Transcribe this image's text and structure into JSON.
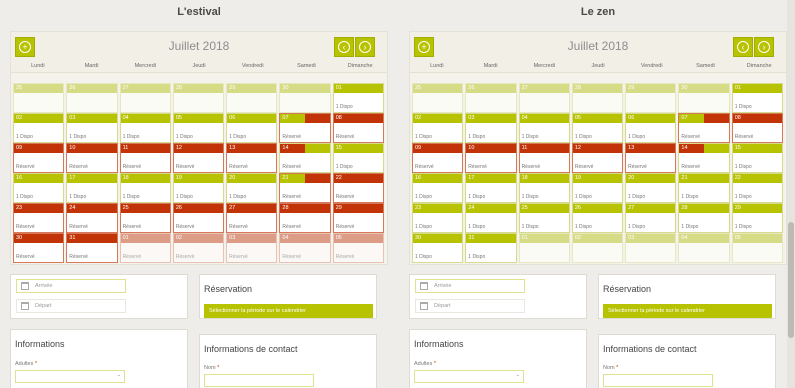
{
  "left": {
    "title": "L'estival",
    "month": "Juillet 2018",
    "dows": [
      "Lundi",
      "Mardi",
      "Mercredi",
      "Jeudi",
      "Vendredi",
      "Samedi",
      "Dimanche"
    ],
    "cells": [
      [
        "25",
        "",
        "od"
      ],
      [
        "26",
        "",
        "od"
      ],
      [
        "27",
        "",
        "od"
      ],
      [
        "28",
        "",
        "od"
      ],
      [
        "29",
        "",
        "od"
      ],
      [
        "30",
        "",
        "od"
      ],
      [
        "01",
        "1 Dispo",
        "d"
      ],
      [
        "02",
        "1 Dispo",
        "d"
      ],
      [
        "03",
        "1 Dispo",
        "d"
      ],
      [
        "04",
        "1 Dispo",
        "d"
      ],
      [
        "05",
        "1 Dispo",
        "d"
      ],
      [
        "06",
        "1 Dispo",
        "d"
      ],
      [
        "07",
        "Réservé",
        "ta"
      ],
      [
        "08",
        "Réservé",
        "r"
      ],
      [
        "09",
        "Réservé",
        "r"
      ],
      [
        "10",
        "Réservé",
        "r"
      ],
      [
        "11",
        "Réservé",
        "r"
      ],
      [
        "12",
        "Réservé",
        "r"
      ],
      [
        "13",
        "Réservé",
        "r"
      ],
      [
        "14",
        "Réservé",
        "tb"
      ],
      [
        "15",
        "1 Dispo",
        "d"
      ],
      [
        "16",
        "1 Dispo",
        "d"
      ],
      [
        "17",
        "1 Dispo",
        "d"
      ],
      [
        "18",
        "1 Dispo",
        "d"
      ],
      [
        "19",
        "1 Dispo",
        "d"
      ],
      [
        "20",
        "1 Dispo",
        "d"
      ],
      [
        "21",
        "Réservé",
        "ta"
      ],
      [
        "22",
        "Réservé",
        "r"
      ],
      [
        "23",
        "Réservé",
        "r"
      ],
      [
        "24",
        "Réservé",
        "r"
      ],
      [
        "25",
        "Réservé",
        "r"
      ],
      [
        "26",
        "Réservé",
        "r"
      ],
      [
        "27",
        "Réservé",
        "r"
      ],
      [
        "28",
        "Réservé",
        "r"
      ],
      [
        "29",
        "Réservé",
        "r"
      ],
      [
        "30",
        "Réservé",
        "r"
      ],
      [
        "31",
        "Réservé",
        "r"
      ],
      [
        "01",
        "Réservé",
        "or"
      ],
      [
        "02",
        "Réservé",
        "or"
      ],
      [
        "03",
        "Réservé",
        "or"
      ],
      [
        "04",
        "Réservé",
        "or"
      ],
      [
        "05",
        "Réservé",
        "or"
      ]
    ],
    "arrivee": "Arrivée",
    "depart": "Départ",
    "reservation_title": "Réservation",
    "select_label": "Sélectionner la période sur le calendrier",
    "info_title": "Informations",
    "adultes_label": "Adultes",
    "contact_title": "Informations de contact",
    "nom_label": "Nom"
  },
  "right": {
    "title": "Le zen",
    "month": "Juillet 2018",
    "dows": [
      "Lundi",
      "Mardi",
      "Mercredi",
      "Jeudi",
      "Vendredi",
      "Samedi",
      "Dimanche"
    ],
    "cells": [
      [
        "25",
        "",
        "od"
      ],
      [
        "26",
        "",
        "od"
      ],
      [
        "27",
        "",
        "od"
      ],
      [
        "28",
        "",
        "od"
      ],
      [
        "29",
        "",
        "od"
      ],
      [
        "30",
        "",
        "od"
      ],
      [
        "01",
        "1 Dispo",
        "d"
      ],
      [
        "02",
        "1 Dispo",
        "d"
      ],
      [
        "03",
        "1 Dispo",
        "d"
      ],
      [
        "04",
        "1 Dispo",
        "d"
      ],
      [
        "05",
        "1 Dispo",
        "d"
      ],
      [
        "06",
        "1 Dispo",
        "d"
      ],
      [
        "07",
        "Réservé",
        "ta"
      ],
      [
        "08",
        "Réservé",
        "r"
      ],
      [
        "09",
        "Réservé",
        "r"
      ],
      [
        "10",
        "Réservé",
        "r"
      ],
      [
        "11",
        "Réservé",
        "r"
      ],
      [
        "12",
        "Réservé",
        "r"
      ],
      [
        "13",
        "Réservé",
        "r"
      ],
      [
        "14",
        "Réservé",
        "tb"
      ],
      [
        "15",
        "1 Dispo",
        "d"
      ],
      [
        "16",
        "1 Dispo",
        "d"
      ],
      [
        "17",
        "1 Dispo",
        "d"
      ],
      [
        "18",
        "1 Dispo",
        "d"
      ],
      [
        "19",
        "1 Dispo",
        "d"
      ],
      [
        "20",
        "1 Dispo",
        "d"
      ],
      [
        "21",
        "1 Dispo",
        "d"
      ],
      [
        "22",
        "1 Dispo",
        "d"
      ],
      [
        "23",
        "1 Dispo",
        "d"
      ],
      [
        "24",
        "1 Dispo",
        "d"
      ],
      [
        "25",
        "1 Dispo",
        "d"
      ],
      [
        "26",
        "1 Dispo",
        "d"
      ],
      [
        "27",
        "1 Dispo",
        "d"
      ],
      [
        "28",
        "1 Dispo",
        "d"
      ],
      [
        "29",
        "1 Dispo",
        "d"
      ],
      [
        "30",
        "1 Dispo",
        "d"
      ],
      [
        "31",
        "1 Dispo",
        "d"
      ],
      [
        "01",
        "",
        "od"
      ],
      [
        "02",
        "",
        "od"
      ],
      [
        "03",
        "",
        "od"
      ],
      [
        "04",
        "",
        "od"
      ],
      [
        "05",
        "",
        "od"
      ]
    ],
    "arrivee": "Arrivée",
    "depart": "Départ",
    "reservation_title": "Réservation",
    "select_label": "Sélectionner la période sur le calendrier",
    "info_title": "Informations",
    "adultes_label": "Adultes",
    "contact_title": "Informations de contact",
    "nom_label": "Nom"
  },
  "icons": {
    "add": "plus-circle-icon",
    "prev": "chevron-left-circle-icon",
    "next": "chevron-right-circle-icon",
    "calendar": "calendar-icon"
  },
  "colors": {
    "available": "#b7c200",
    "reserved": "#c23407"
  }
}
